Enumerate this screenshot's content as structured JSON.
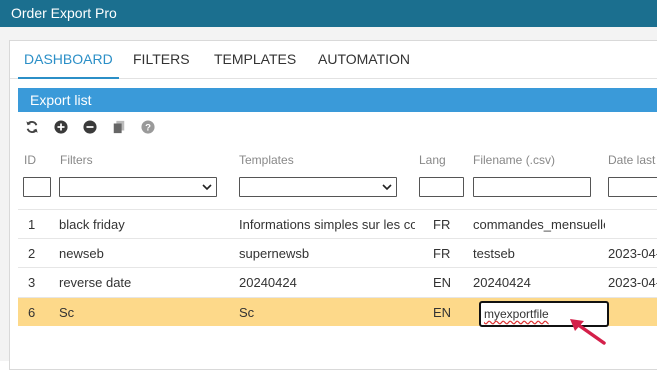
{
  "app": {
    "title": "Order Export Pro"
  },
  "tabs": [
    {
      "label": "DASHBOARD",
      "active": true
    },
    {
      "label": "FILTERS"
    },
    {
      "label": "TEMPLATES"
    },
    {
      "label": "AUTOMATION"
    }
  ],
  "grid": {
    "title": "Export list",
    "toolbar": [
      "refresh-icon",
      "add-icon",
      "remove-icon",
      "copy-icon",
      "help-icon"
    ],
    "columns": [
      "ID",
      "Filters",
      "Templates",
      "Lang",
      "Filename (.csv)",
      "Date last"
    ],
    "rows": [
      {
        "id": "1",
        "filter": "black friday",
        "template": "Informations simples sur les commandes",
        "lang": "FR",
        "filename": "commandes_mensuelles",
        "date": ""
      },
      {
        "id": "2",
        "filter": "newseb",
        "template": "supernewsb",
        "lang": "FR",
        "filename": "testseb",
        "date": "2023-04-"
      },
      {
        "id": "3",
        "filter": "reverse date",
        "template": "20240424",
        "lang": "EN",
        "filename": "20240424",
        "date": "2023-04-"
      },
      {
        "id": "6",
        "filter": "Sc",
        "template": "Sc",
        "lang": "EN",
        "filename": "myexportfile",
        "date": ""
      }
    ]
  },
  "colors": {
    "titlebar": "#1b6f8f",
    "header": "#3a9ad9",
    "selected_row": "#fdd98a",
    "active_tab": "#2b8fc7",
    "arrow": "#d4204a"
  }
}
